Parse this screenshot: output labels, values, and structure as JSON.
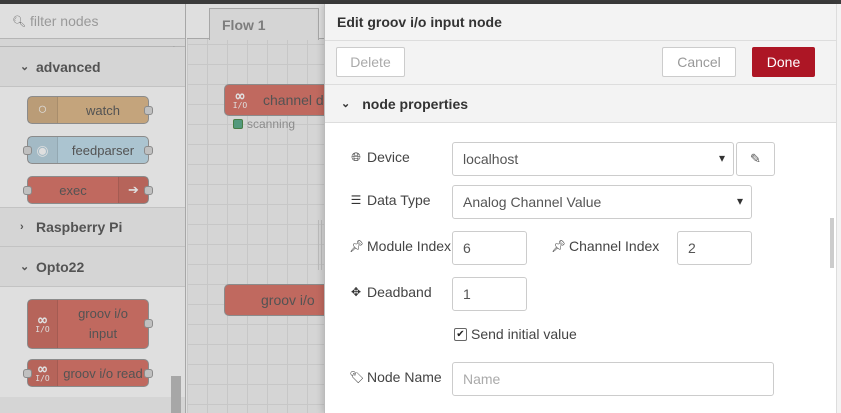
{
  "palette": {
    "search_placeholder": "filter nodes",
    "categories": {
      "advanced": "advanced",
      "raspberry": "Raspberry Pi",
      "opto22": "Opto22"
    },
    "advanced_nodes": [
      "watch",
      "feedparser",
      "exec"
    ],
    "opto_nodes": [
      "groov i/o input",
      "groov i/o read"
    ],
    "io_icon_text": "I/O"
  },
  "workspace": {
    "tab": "Flow 1",
    "node1_label": "channel d",
    "node1_status": "scanning",
    "node2_label": "groov i/o"
  },
  "tray": {
    "title": "Edit groov i/o input node",
    "delete": "Delete",
    "cancel": "Cancel",
    "done": "Done",
    "section": "node properties",
    "device_label": "Device",
    "device_value": "localhost",
    "datatype_label": "Data Type",
    "datatype_value": "Analog Channel Value",
    "module_label": "Module Index",
    "module_value": "6",
    "channel_label": "Channel Index",
    "channel_value": "2",
    "deadband_label": "Deadband",
    "deadband_value": "1",
    "send_initial_label": "Send initial value",
    "send_initial_checked": true,
    "name_label": "Node Name",
    "name_placeholder": "Name"
  },
  "colors": {
    "done_button": "#ad1625",
    "opto_node": "#d96f63",
    "watch_node": "#deb887",
    "feedparser_node": "#c0deed",
    "exec_node": "#d96f63"
  }
}
